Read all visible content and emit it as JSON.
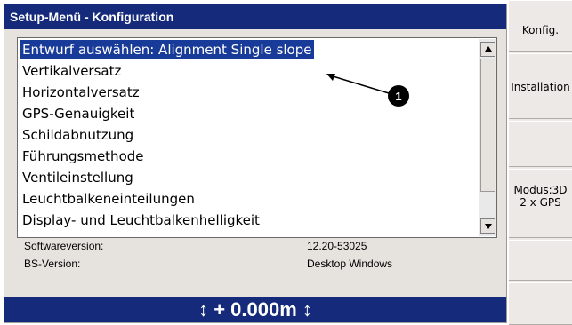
{
  "window": {
    "title": "Setup-Menü - Konfiguration"
  },
  "list": {
    "items": [
      {
        "label": "Entwurf auswählen: Alignment Single slope",
        "selected": true
      },
      {
        "label": "Vertikalversatz",
        "selected": false
      },
      {
        "label": "Horizontalversatz",
        "selected": false
      },
      {
        "label": "GPS-Genauigkeit",
        "selected": false
      },
      {
        "label": "Schildabnutzung",
        "selected": false
      },
      {
        "label": "Führungsmethode",
        "selected": false
      },
      {
        "label": "Ventileinstellung",
        "selected": false
      },
      {
        "label": "Leuchtbalkeneinteilungen",
        "selected": false
      },
      {
        "label": "Display- und Leuchtbalkenhelligkeit",
        "selected": false
      }
    ]
  },
  "callout": {
    "number": "1"
  },
  "info": {
    "software_label": "Softwareversion:",
    "software_value": "12.20-53025",
    "os_label": "BS-Version:",
    "os_value": "Desktop Windows"
  },
  "bottom": {
    "offset_text": "↕ + 0.000m ↕"
  },
  "sidebar": {
    "buttons": [
      {
        "label": "Konfig."
      },
      {
        "label": "Installation"
      },
      {
        "label": ""
      },
      {
        "label_line1": "Modus:3D",
        "label_line2": "2 x GPS"
      },
      {
        "label": ""
      },
      {
        "label": ""
      }
    ]
  },
  "colors": {
    "titlebar": "#152a7a",
    "selection": "#183a99",
    "panel": "#e6e3df"
  }
}
